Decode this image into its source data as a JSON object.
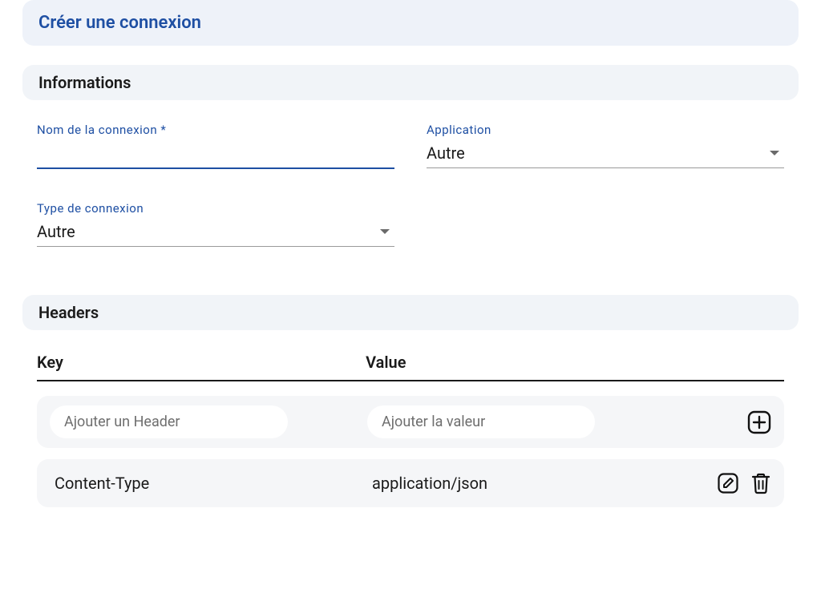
{
  "page": {
    "title": "Créer une connexion"
  },
  "sections": {
    "info": {
      "title": "Informations",
      "fields": {
        "name": {
          "label": "Nom de la connexion *",
          "value": ""
        },
        "application": {
          "label": "Application",
          "value": "Autre"
        },
        "type": {
          "label": "Type de connexion",
          "value": "Autre"
        }
      }
    },
    "headers": {
      "title": "Headers",
      "columns": {
        "key": "Key",
        "value": "Value"
      },
      "addRow": {
        "keyPlaceholder": "Ajouter un Header",
        "valuePlaceholder": "Ajouter la valeur"
      },
      "rows": [
        {
          "key": "Content-Type",
          "value": "application/json"
        }
      ]
    }
  }
}
